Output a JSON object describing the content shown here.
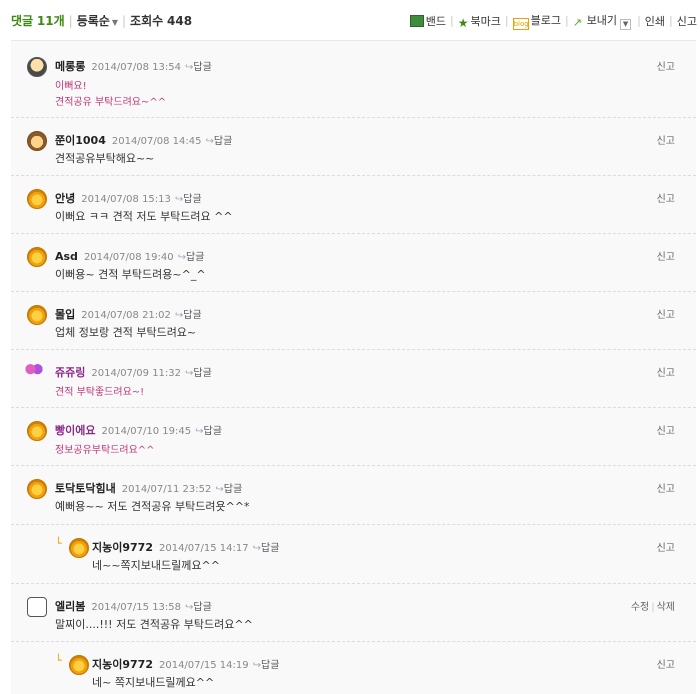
{
  "topbar": {
    "comment_label": "댓글",
    "comment_count": "11개",
    "sort_label": "등록순",
    "views_label": "조회수",
    "views_count": "448",
    "band": "밴드",
    "bookmark": "북마크",
    "blog_badge": "blog",
    "blog": "블로그",
    "send": "보내기",
    "print": "인쇄",
    "report": "신고"
  },
  "reply_label": "답글",
  "report_label": "신고",
  "edit_label": "수정",
  "delete_label": "삭제",
  "comments": [
    {
      "nick": "메롱롱",
      "date": "2014/07/08 13:54",
      "body": [
        "이뻐요!",
        "견적공유 부탁드려요~^^"
      ]
    },
    {
      "nick": "쭌이1004",
      "date": "2014/07/08 14:45",
      "body": [
        "견적공유부탁해요~~"
      ]
    },
    {
      "nick": "안녕",
      "date": "2014/07/08 15:13",
      "body": [
        "이뻐요 ㅋㅋ 견적 저도 부탁드려요 ^^"
      ]
    },
    {
      "nick": "Asd",
      "date": "2014/07/08 19:40",
      "body": [
        "이뻐용~ 견적 부탁드려용~^_^"
      ]
    },
    {
      "nick": "몰입",
      "date": "2014/07/08 21:02",
      "body": [
        "업체 정보랑 견적 부탁드려요~"
      ]
    },
    {
      "nick": "쥬쥬링",
      "date": "2014/07/09 11:32",
      "body": [
        "견적 부탁좋드려요~!"
      ]
    },
    {
      "nick": "빵이에요",
      "date": "2014/07/10 19:45",
      "body": [
        "정보공유부탁드려요^^"
      ]
    },
    {
      "nick": "토닥토닥힘내",
      "date": "2014/07/11 23:52",
      "body": [
        "예뻐용~~ 저도 견적공유 부탁드려욧^^*"
      ]
    },
    {
      "nick": "지농이9772",
      "date": "2014/07/15 14:17",
      "body": [
        "네~~쪽지보내드릴께요^^"
      ]
    },
    {
      "nick": "엘리봄",
      "date": "2014/07/15 13:58",
      "body": [
        "말찌이....!!! 저도 견적공유 부탁드려요^^"
      ]
    },
    {
      "nick": "지농이9772",
      "date": "2014/07/15 14:19",
      "body": [
        "네~ 쪽지보내드릴께요^^"
      ]
    }
  ]
}
